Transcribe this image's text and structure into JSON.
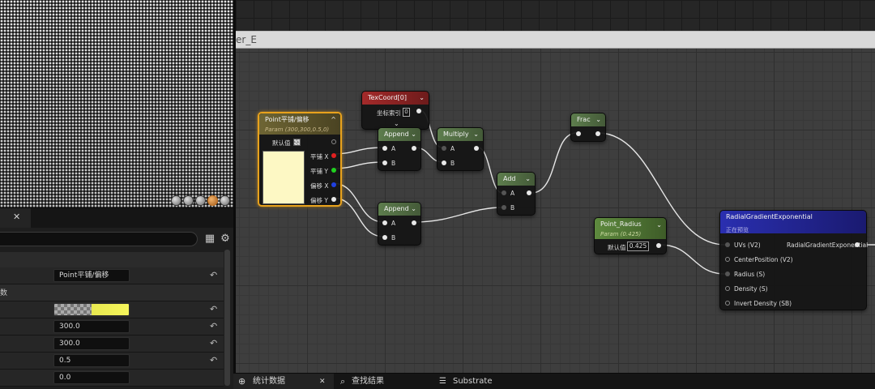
{
  "graph": {
    "title_fragment": "er_E"
  },
  "details": {
    "rows": [
      {
        "value": "Point平铺/偏移"
      },
      {
        "category": "数"
      },
      {
        "value": ""
      },
      {
        "value": "300.0"
      },
      {
        "value": "300.0"
      },
      {
        "value": "0.5"
      },
      {
        "value": "0.0"
      }
    ]
  },
  "nodes": {
    "point_param": {
      "title": "Point平铺/偏移",
      "subtitle": "Param (300,300,0.5,0)",
      "default_label": "默认值",
      "outputs": [
        "平铺 X",
        "平铺 Y",
        "偏移 X",
        "偏移 Y"
      ]
    },
    "texcoord": {
      "title": "TexCoord[0]",
      "index_label": "坐标索引",
      "index_value": "0"
    },
    "append1": {
      "title": "Append",
      "pins": [
        "A",
        "B"
      ]
    },
    "append2": {
      "title": "Append",
      "pins": [
        "A",
        "B"
      ]
    },
    "multiply": {
      "title": "Multiply",
      "pins": [
        "A",
        "B"
      ]
    },
    "add": {
      "title": "Add",
      "pins": [
        "A",
        "B"
      ]
    },
    "frac": {
      "title": "Frac"
    },
    "point_radius": {
      "title": "Point_Radius",
      "subtitle": "Param (0.425)",
      "default_label": "默认值",
      "value": "0.425"
    },
    "radial": {
      "title": "RadialGradientExponential",
      "subtitle": "正在预览",
      "inputs": [
        "UVs (V2)",
        "CenterPosition (V2)",
        "Radius (S)",
        "Density (S)",
        "Invert Density (SB)"
      ],
      "output": "RadialGradientExponential"
    }
  },
  "bottom_tabs": [
    {
      "label": "统计数据",
      "icon": "stats-icon"
    },
    {
      "label": "查找结果",
      "icon": "search-icon"
    },
    {
      "label": "Substrate",
      "icon": "layers-icon"
    }
  ],
  "colors": {
    "selection": "#e8a21c",
    "pin_red": "#e02020",
    "pin_green": "#20d020",
    "pin_blue": "#2040e0"
  }
}
